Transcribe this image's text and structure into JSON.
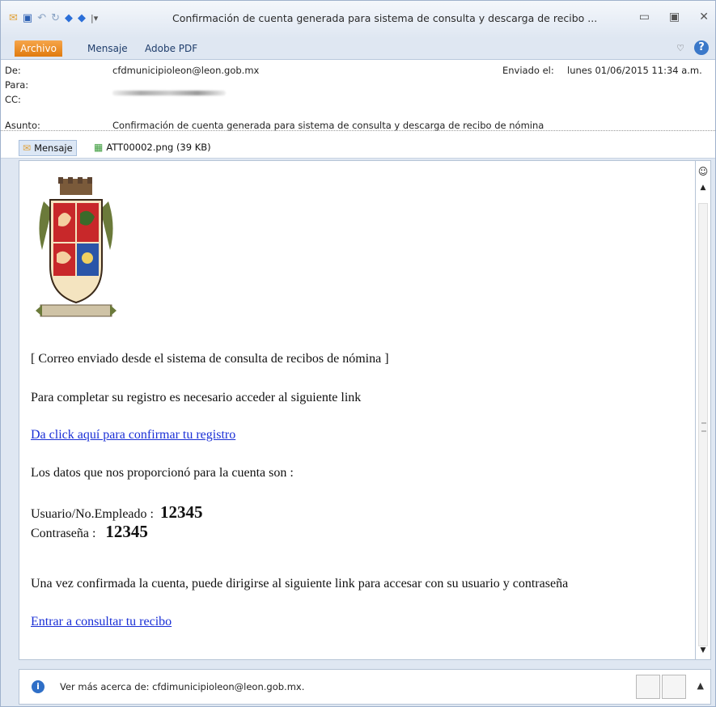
{
  "window": {
    "title": "Confirmación de cuenta generada para sistema de consulta y descarga de recibo ...",
    "controls": [
      "minimize-icon",
      "maximize-icon",
      "close-icon"
    ]
  },
  "ribbon": {
    "tabs": [
      "Archivo",
      "Mensaje",
      "Adobe PDF"
    ]
  },
  "header": {
    "from_label": "De:",
    "from_value": "cfdmunicipioleon@leon.gob.mx",
    "to_label": "Para:",
    "cc_label": "CC:",
    "subject_label": "Asunto:",
    "subject_value": "Confirmación de cuenta generada para sistema de consulta y descarga de recibo de nómina",
    "sent_label": "Enviado el:",
    "sent_value": "lunes 01/06/2015 11:34 a.m."
  },
  "attachments": {
    "message_label": "Mensaje",
    "file_label": "ATT00002.png (39 KB)"
  },
  "body": {
    "line1": "[ Correo enviado desde el sistema de consulta de recibos de nómina ]",
    "line2": "Para completar su registro es necesario acceder al siguiente link",
    "link1": "Da click aquí para confirmar tu registro",
    "line3": "Los datos que nos proporcionó para la cuenta son :",
    "user_label": "Usuario/No.Empleado :",
    "user_value": "12345",
    "pass_label": "Contraseña :",
    "pass_value": "12345",
    "line4": "Una vez confirmada la cuenta, puede dirigirse al siguiente link para accesar con su usuario y contraseña",
    "link2": "Entrar a consultar tu recibo"
  },
  "footer": {
    "text": "Ver más acerca de: cfdimunicipioleon@leon.gob.mx."
  },
  "colors": {
    "accent_tab": "#e07b0f",
    "link": "#1a2fd6",
    "chrome": "#dfe7f2"
  }
}
